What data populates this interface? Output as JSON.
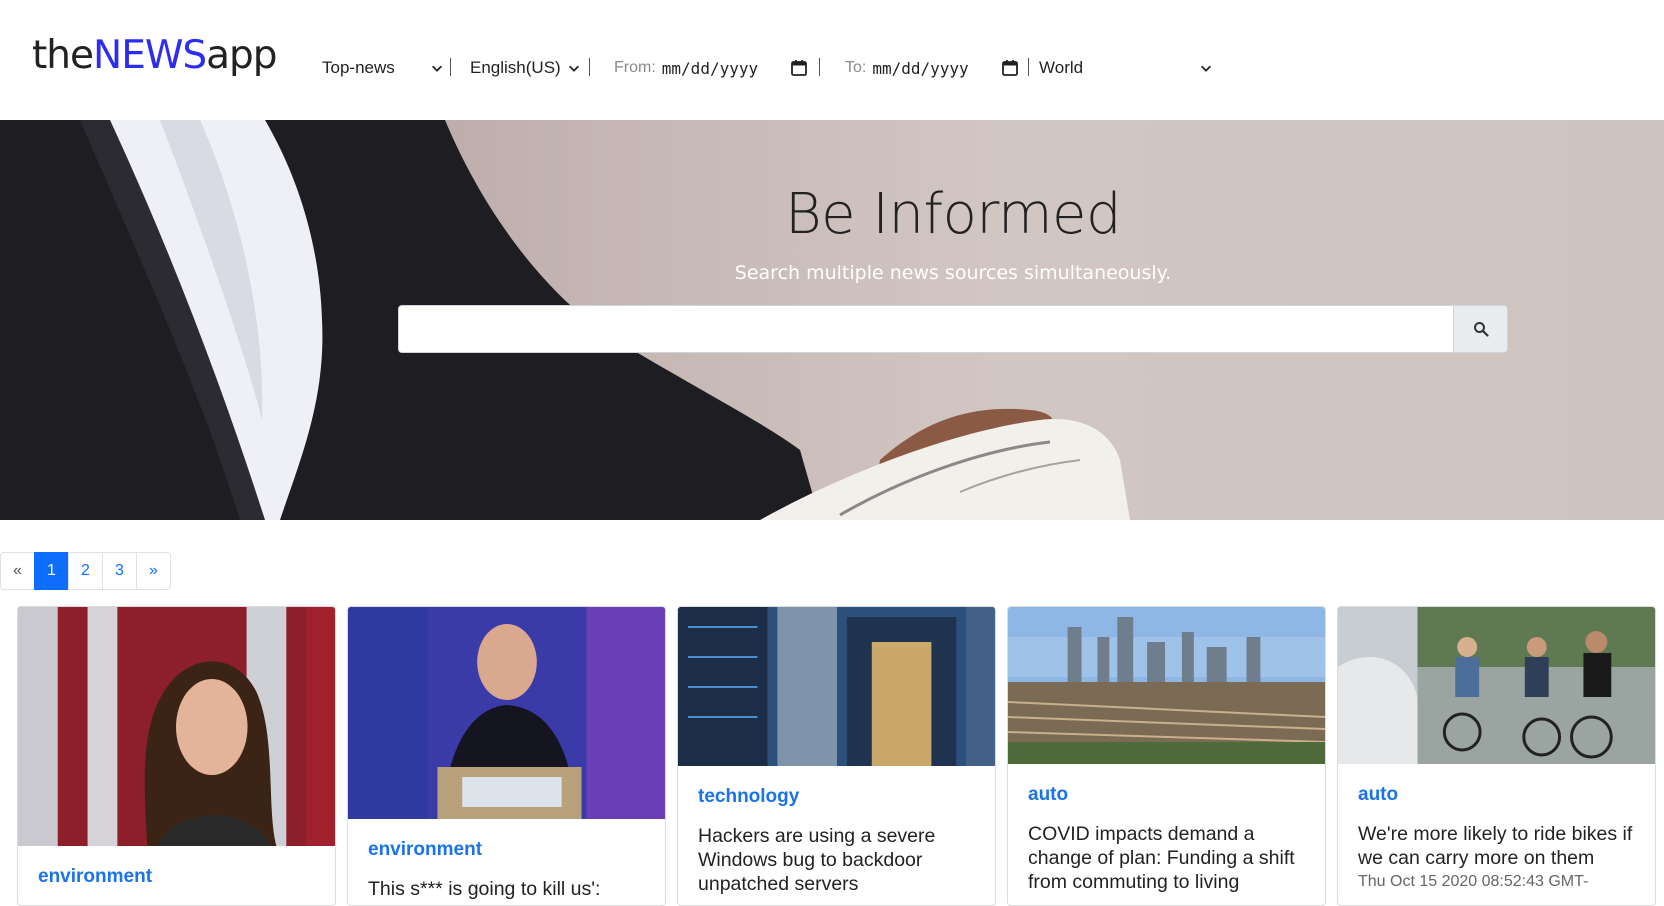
{
  "brand": {
    "prefix": "the",
    "highlight": "NEWS",
    "suffix": "app"
  },
  "filters": {
    "category": "Top-news",
    "language": "English(US)",
    "from_label": "From:",
    "from_value": "mm/dd/yyyy",
    "to_label": "To:",
    "to_value": "mm/dd/yyyy",
    "region": "World"
  },
  "hero": {
    "title": "Be Informed",
    "subtitle": "Search multiple news sources simultaneously.",
    "search_placeholder": "",
    "search_icon": "search-icon"
  },
  "pagination": {
    "prev": "«",
    "pages": [
      "1",
      "2",
      "3"
    ],
    "next": "»",
    "active": "1"
  },
  "cards": [
    {
      "category": "environment",
      "title": "",
      "date": "",
      "image": "portrait-woman-flag"
    },
    {
      "category": "environment",
      "title": "This s*** is going to kill us':",
      "date": "",
      "image": "speaker-global-climate-summit"
    },
    {
      "category": "technology",
      "title": "Hackers are using a severe Windows bug to backdoor unpatched servers",
      "date": "",
      "image": "server-racks"
    },
    {
      "category": "auto",
      "title": "COVID impacts demand a change of plan: Funding a shift from commuting to living",
      "date": "",
      "image": "city-skyline-railyard"
    },
    {
      "category": "auto",
      "title": "We're more likely to ride bikes if we can carry more on them",
      "date": "Thu Oct 15 2020 08:52:43 GMT-",
      "image": "cyclists-street"
    }
  ],
  "colors": {
    "brand_highlight": "#2d2df0",
    "category": "#1a73e8",
    "page_active": "#0d6efd"
  }
}
